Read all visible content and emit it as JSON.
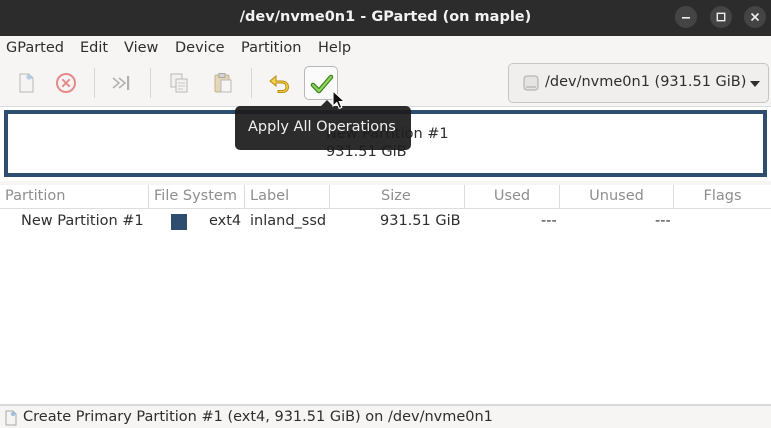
{
  "window": {
    "title": "/dev/nvme0n1 - GParted (on maple)"
  },
  "menu": {
    "items": [
      {
        "label": "GParted"
      },
      {
        "label": "Edit"
      },
      {
        "label": "View"
      },
      {
        "label": "Device"
      },
      {
        "label": "Partition"
      },
      {
        "label": "Help"
      }
    ]
  },
  "toolbar": {
    "buttons": [
      "new-icon",
      "delete-icon",
      "resize-move-icon",
      "copy-icon",
      "paste-icon",
      "undo-icon",
      "apply-icon"
    ],
    "tooltip": "Apply All Operations"
  },
  "device": {
    "selected": "/dev/nvme0n1 (931.51 GiB)"
  },
  "disk_map": {
    "partition_name": "New Partition #1",
    "partition_size": "931.51 GiB",
    "color": "#2f4d6f"
  },
  "table": {
    "columns": [
      "Partition",
      "File System",
      "Label",
      "Size",
      "Used",
      "Unused",
      "Flags"
    ],
    "rows": [
      {
        "partition": "New Partition #1",
        "fs_color": "#2f4d6f",
        "file_system": "ext4",
        "label": "inland_ssd",
        "size": "931.51 GiB",
        "used": "---",
        "unused": "---",
        "flags": ""
      }
    ]
  },
  "status": {
    "pending_operation": "Create Primary Partition #1 (ext4, 931.51 GiB) on /dev/nvme0n1"
  }
}
